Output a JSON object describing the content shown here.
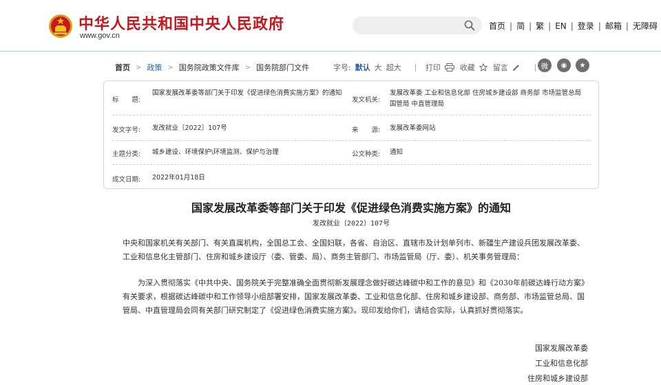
{
  "header": {
    "title": "中华人民共和国中央人民政府",
    "url": "www.gov.cn",
    "search_placeholder": "",
    "links": [
      "首页",
      "简",
      "繁",
      "EN",
      "登录",
      "邮箱",
      "无障碍"
    ]
  },
  "breadcrumb": {
    "items": [
      "首页",
      "政策",
      "国务院政策文件库",
      "国务院部门文件"
    ]
  },
  "tools": {
    "font_label": "字号:",
    "font_default": "默认",
    "font_large": "大",
    "font_xlarge": "超大",
    "print": "打印",
    "favorite": "收藏",
    "message": "留言"
  },
  "meta": {
    "title_label": "标　　题:",
    "title_value": "国家发展改革委等部门关于印发《促进绿色消费实施方案》的通知",
    "issuer_label": "发文机关:",
    "issuer_value": "发展改革委 工业和信息化部 住房城乡建设部 商务部 市场监管总局 国管局 中直管理局",
    "docno_label": "发文字号:",
    "docno_value": "发改就业〔2022〕107号",
    "source_label": "来　　源:",
    "source_value": "发展改革委网站",
    "topic_label": "主题分类:",
    "topic_value": "城乡建设、环境保护\\环境监测、保护与治理",
    "type_label": "公文种类:",
    "type_value": "通知",
    "date_label": "成文日期:",
    "date_value": "2022年01月18日"
  },
  "article": {
    "title": "国家发展改革委等部门关于印发《促进绿色消费实施方案》的通知",
    "doc_no": "发改就业〔2022〕107号",
    "p1": "中央和国家机关有关部门、有关直属机构，全国总工会、全国妇联，各省、自治区、直辖市及计划单列市、新疆生产建设兵团发展改革委、工业和信息化主管部门、住房和城乡建设厅（委、管委、局）、商务主管部门、市场监管局（厅、委）、机关事务管理局：",
    "p2": "为深入贯彻落实《中共中央、国务院关于完整准确全面贯彻新发展理念做好碳达峰碳中和工作的意见》和《2030年前碳达峰行动方案》有关要求，根据碳达峰碳中和工作领导小组部署安排，国家发展改革委、工业和信息化部、住房和城乡建设部、商务部、市场监管总局、国管局、中直管理局会同有关部门研究制定了《促进绿色消费实施方案》。现印发给你们，请结合实际，认真抓好贯彻落实。",
    "signatures": [
      "国家发展改革委",
      "工业和信息化部",
      "住房和城乡建设部"
    ]
  },
  "colors": {
    "brand_red": "#c8161d",
    "link_blue": "#2a5f9e"
  }
}
